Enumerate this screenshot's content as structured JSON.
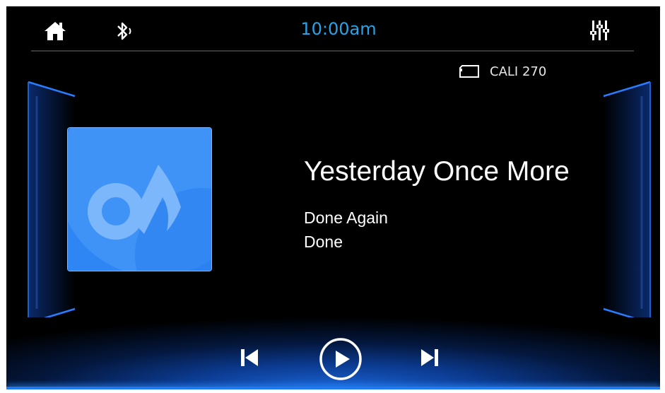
{
  "header": {
    "clock": "10:00am",
    "home_icon": "home-icon",
    "bluetooth_icon": "bluetooth-audio-icon",
    "equalizer_icon": "equalizer-icon"
  },
  "source": {
    "icon": "sd-card-icon",
    "label": "CALI 270"
  },
  "track": {
    "title": "Yesterday Once More",
    "artist": "Done Again",
    "album": "Done"
  },
  "controls": {
    "previous_icon": "skip-previous-icon",
    "play_icon": "play-icon",
    "next_icon": "skip-next-icon"
  },
  "colors": {
    "accent": "#29a3e6",
    "glow": "#1f7af0",
    "art_background": "#3d8ff6"
  }
}
